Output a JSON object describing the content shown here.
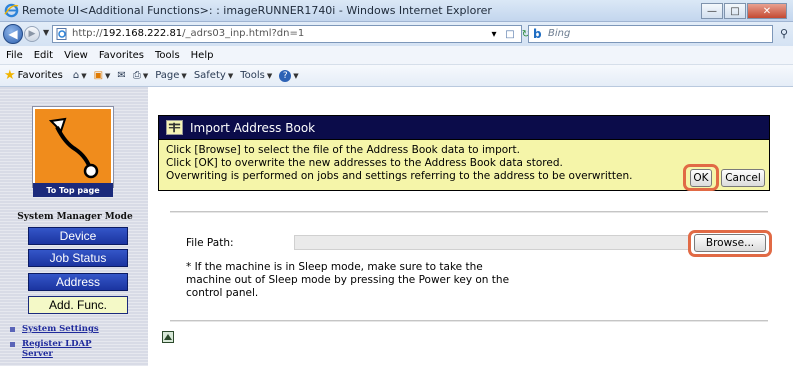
{
  "window": {
    "title": "Remote UI<Additional Functions>: : imageRUNNER1740i - Windows Internet Explorer",
    "min_icon": "minimize-icon",
    "max_icon": "maximize-icon",
    "close_icon": "close-icon"
  },
  "address": {
    "url_prefix": "http://",
    "url_host": "192.168.222.81",
    "url_path": "/_adrs03_inp.html?dn=1",
    "search_placeholder": "Bing"
  },
  "menu": [
    "File",
    "Edit",
    "View",
    "Favorites",
    "Tools",
    "Help"
  ],
  "favbar": {
    "favorites": "Favorites",
    "page": "Page",
    "safety": "Safety",
    "tools": "Tools"
  },
  "sidebar": {
    "to_top": "To Top page",
    "mode_title": "System Manager Mode",
    "buttons": [
      "Device",
      "Job Status",
      "Address",
      "Add. Func."
    ],
    "active_button": "Add. Func.",
    "links": [
      "System Settings",
      "Register LDAP",
      "Server"
    ]
  },
  "panel": {
    "title": "Import Address Book",
    "instructions": [
      "Click [Browse] to select the file of the Address Book data to import.",
      "Click [OK] to overwrite the new addresses to the Address Book data stored.",
      "Overwriting is performed on jobs and settings referring to the address to be overwritten."
    ],
    "ok_label": "OK",
    "cancel_label": "Cancel",
    "file_path_label": "File Path:",
    "file_path_value": "",
    "browse_label": "Browse...",
    "note_lines": [
      "* If the machine is in Sleep mode, make sure to take the",
      "machine out of Sleep mode by pressing the Power key on the",
      "control panel."
    ]
  },
  "colors": {
    "highlight": "#e16a45",
    "header_bg": "#0b0c4a",
    "instruction_bg": "#f5f5a9",
    "nav_button": "#2440b4",
    "nav_active": "#f4f9c7"
  }
}
